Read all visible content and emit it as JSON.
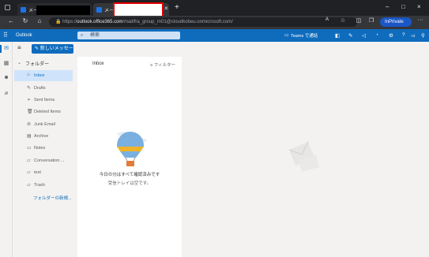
{
  "browser": {
    "tabs": [
      {
        "label": "メー"
      },
      {
        "label": "メー"
      }
    ],
    "new_tab_glyph": "+",
    "close_glyph": "×",
    "url_prefix": "https://",
    "url_host": "outlook.office365.com",
    "url_path": "/mail/fra_group_rn01@cloudkobeu.onmicrosoft.com/",
    "inprivate_label": "InPrivate",
    "more_glyph": "···"
  },
  "outlook": {
    "app_name": "Outlook",
    "search_placeholder": "検索",
    "teams_label": "Teams で通話",
    "new_message_label": "新しいメッセージ",
    "favorites_header": "フォルダー",
    "folders": [
      {
        "label": "Inbox",
        "icon": "inbox-icon",
        "selected": true
      },
      {
        "label": "Drafts",
        "icon": "pencil-icon"
      },
      {
        "label": "Sent Items",
        "icon": "send-icon"
      },
      {
        "label": "Deleted Items",
        "icon": "trash-icon"
      },
      {
        "label": "Junk Email",
        "icon": "junk-icon"
      },
      {
        "label": "Archive",
        "icon": "archive-icon"
      },
      {
        "label": "Notes",
        "icon": "note-icon"
      },
      {
        "label": "Conversation ...",
        "icon": "folder-icon"
      },
      {
        "label": "test",
        "icon": "folder-icon"
      },
      {
        "label": "Trash",
        "icon": "folder-icon"
      }
    ],
    "new_folder_label": "フォルダーの新規...",
    "message_list": {
      "title": "Inbox",
      "filter_label": "フィルター",
      "empty_title": "今日の分はすべて確認済みです",
      "empty_subtitle": "受信トレイは空です。"
    }
  },
  "colors": {
    "brand": "#0f6cbd",
    "selected_folder": "#cfe4fa",
    "redaction_border": "#e00000"
  }
}
